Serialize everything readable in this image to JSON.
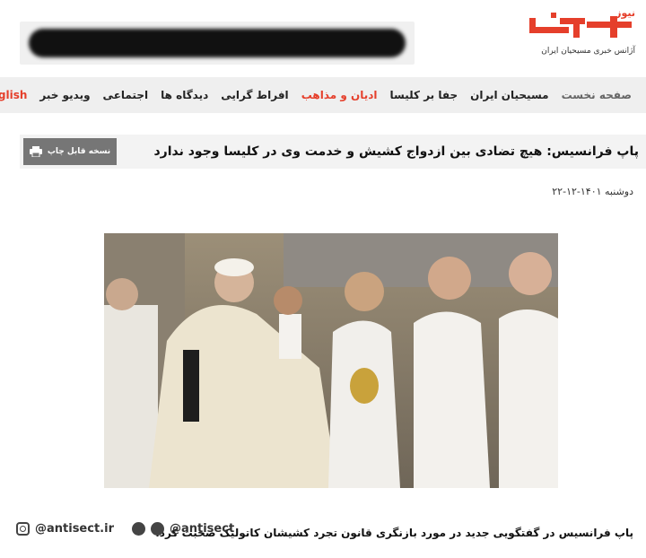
{
  "site": {
    "logo_top": "نیوز",
    "logo_mark": "کلیسا",
    "logo_sub": "آژانس خبری مسیحیان ایران"
  },
  "nav": {
    "items": [
      {
        "label": "صفحه نخست",
        "style": "muted"
      },
      {
        "label": "مسیحیان ایران",
        "style": "normal"
      },
      {
        "label": "جفا بر کلیسا",
        "style": "normal"
      },
      {
        "label": "ادیان و مذاهب",
        "style": "accent"
      },
      {
        "label": "افراط گرایی",
        "style": "normal"
      },
      {
        "label": "دیدگاه ها",
        "style": "normal"
      },
      {
        "label": "اجتماعی",
        "style": "normal"
      },
      {
        "label": "ویدیو خبر",
        "style": "normal"
      },
      {
        "label": "English",
        "style": "accent"
      }
    ]
  },
  "article": {
    "title": "پاپ فرانسیس: هیچ تضادی بین ازدواج کشیش و خدمت وی در کلیسا وجود ندارد",
    "print_label": "نسخه قابل چاپ",
    "date": "دوشنبه ۱۴۰۱-۱۲-۲۲",
    "caption": "پاپ فرانسیس در گفتگویی جدید در مورد بازنگری قانون تجرد کشیشان کاتولیک صحبت کرد."
  },
  "social": {
    "handle_1": "@antisect",
    "handle_2": "@antisect.ir"
  },
  "colors": {
    "accent": "#e53f2b",
    "nav_bg": "#efefef",
    "print_btn": "#767676"
  }
}
